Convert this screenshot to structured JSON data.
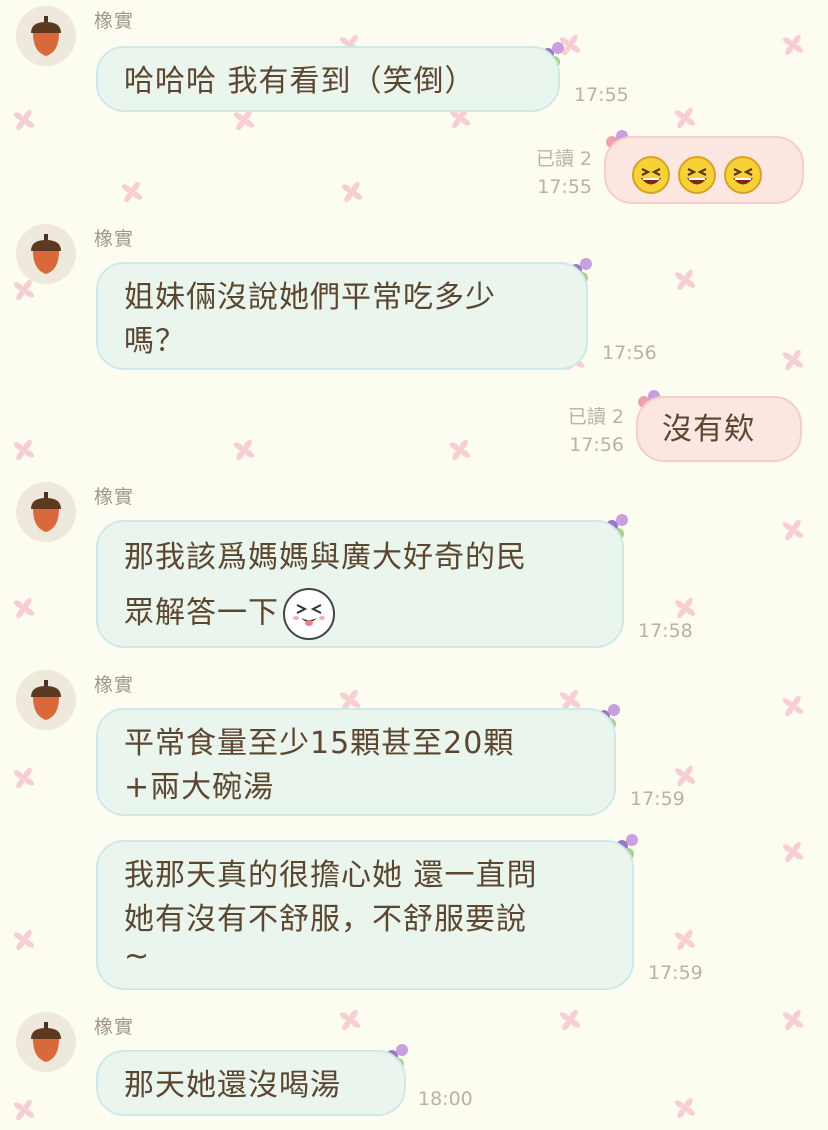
{
  "chat": {
    "messages": [
      {
        "sender": "橡實",
        "text": "哈哈哈 我有看到（笑倒）",
        "time": "17:55"
      },
      {
        "read": "已讀 2",
        "time": "17:55",
        "emoji": "laughing-emoji"
      },
      {
        "sender": "橡實",
        "lines": [
          "姐妹倆沒說她們平常吃多少",
          "嗎？"
        ],
        "time": "17:56"
      },
      {
        "read": "已讀 2",
        "time": "17:56",
        "text": "沒有欸"
      },
      {
        "sender": "橡實",
        "lines": [
          "那我該爲媽媽與廣大好奇的民",
          "眾解答一下"
        ],
        "time": "17:58"
      },
      {
        "sender": "橡實",
        "lines": [
          "平常食量至少15顆甚至20顆",
          "+兩大碗湯"
        ],
        "time": "17:59"
      },
      {
        "lines": [
          "我那天真的很擔心她 還一直問",
          "她有沒有不舒服，不舒服要說",
          "~"
        ],
        "time": "17:59"
      },
      {
        "sender": "橡實",
        "text": "那天她還沒喝湯",
        "time": "18:00"
      }
    ]
  },
  "colors": {
    "background": "#fdfcf0",
    "incoming_bubble": "#eaf5ee",
    "outgoing_bubble": "#fbe6e1",
    "text": "#5c4630",
    "timestamp": "#b8b3a4"
  }
}
